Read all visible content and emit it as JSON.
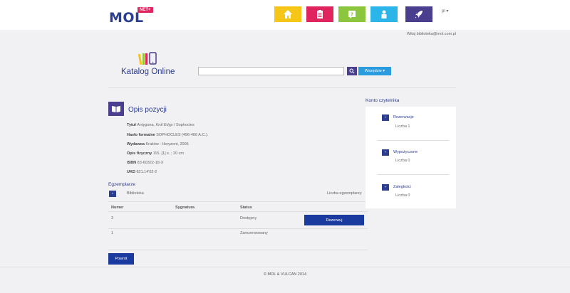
{
  "header": {
    "logo_text": "MOL",
    "logo_badge": "NET+",
    "lang": "pl ▾",
    "nav": [
      {
        "name": "home",
        "color": "#f5c518",
        "icon": "home-icon"
      },
      {
        "name": "documents",
        "color": "#e0245e",
        "icon": "clipboard-icon"
      },
      {
        "name": "help",
        "color": "#8cc63f",
        "icon": "question-icon"
      },
      {
        "name": "account",
        "color": "#2bb5e8",
        "icon": "user-icon"
      },
      {
        "name": "start",
        "color": "#4a3f8f",
        "icon": "rocket-icon"
      }
    ],
    "welcome": "Witaj biblioteka@mol.com.pl"
  },
  "catalog": {
    "title": "Katalog Online",
    "search_placeholder": "",
    "where_label": "Wszędzie ▾"
  },
  "item": {
    "section_title": "Opis pozycji",
    "title_label": "Tytuł",
    "title_value": "Antygona, Król Edyp",
    "title_author": " / Sophocles",
    "heading_label": "Hasło formalne",
    "heading_value": "SOPHOCLES (496-406 A.C.).",
    "publisher_label": "Wydawca",
    "publisher_value": "Kraków : Horyzont, 2005",
    "physical_label": "Opis fizyczny",
    "physical_value": "115, [1] s. ; 20 cm",
    "isbn_label": "ISBN",
    "isbn_value": "83-60322-18-X",
    "ukd_label": "UKD",
    "ukd_value": "821.14'02-2"
  },
  "copies": {
    "title": "Egzemplarze",
    "library_label": "Biblioteka",
    "count_label": "Liczba egzemplarzy",
    "columns": [
      "Numer",
      "Sygnatura",
      "Status"
    ],
    "rows": [
      {
        "number": "3",
        "signature": "",
        "status": "Dostępny",
        "action": "Rezerwuj"
      },
      {
        "number": "1",
        "signature": "",
        "status": "Zarezerwowany",
        "action": ""
      }
    ],
    "back_label": "Powrót"
  },
  "account": {
    "title": "Konto czytelnika",
    "sections": [
      {
        "label": "Rezerwacje",
        "count": "Liczba 1"
      },
      {
        "label": "Wypożyczone",
        "count": "Liczba 0"
      },
      {
        "label": "Zaległości",
        "count": "Liczba 0"
      }
    ]
  },
  "footer": {
    "text": "© MOL & VULCAN 2014"
  }
}
